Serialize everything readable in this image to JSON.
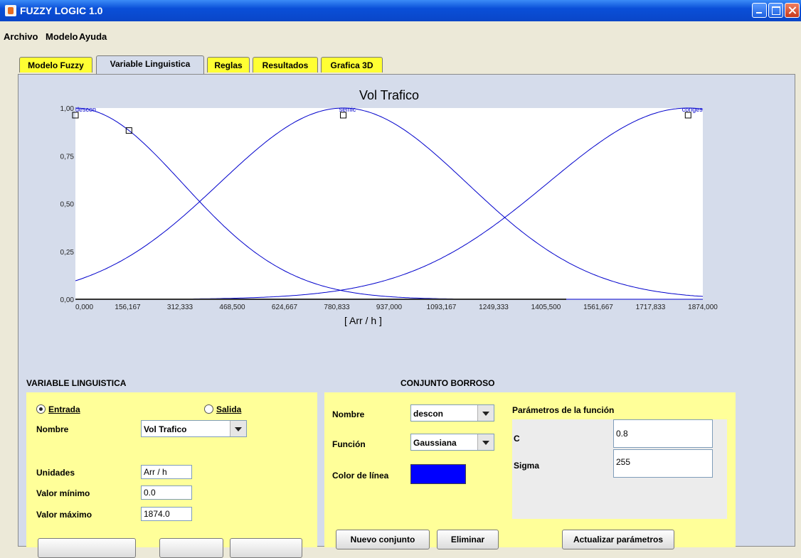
{
  "window": {
    "title": "FUZZY LOGIC 1.0"
  },
  "menu": [
    "Archivo",
    "Modelo",
    "Ayuda"
  ],
  "tabs": [
    {
      "label": "Modelo Fuzzy",
      "active": false
    },
    {
      "label": "Variable Linguistica",
      "active": true
    },
    {
      "label": "Reglas",
      "active": false
    },
    {
      "label": "Resultados",
      "active": false
    },
    {
      "label": "Grafica 3D",
      "active": false
    }
  ],
  "chart_data": {
    "type": "line",
    "title": "Vol Trafico",
    "xlabel": "[ Arr / h ]",
    "ylabel": "",
    "xlim": [
      0,
      1874
    ],
    "ylim": [
      0,
      1
    ],
    "x_ticks": [
      "0,000",
      "156,167",
      "312,333",
      "468,500",
      "624,667",
      "780,833",
      "937,000",
      "1093,167",
      "1249,333",
      "1405,500",
      "1561,667",
      "1717,833",
      "1874,000"
    ],
    "y_ticks": [
      "0,00",
      "0,25",
      "0,50",
      "0,75",
      "1,00"
    ],
    "series": [
      {
        "name": "descon",
        "function": "gaussian",
        "center": 0,
        "sigma": 320,
        "color": "#0000cc"
      },
      {
        "name": "semic",
        "function": "gaussian",
        "center": 800,
        "sigma": 370,
        "color": "#0000cc"
      },
      {
        "name": "conges",
        "function": "gaussian",
        "center": 1830,
        "sigma": 420,
        "color": "#0000cc"
      }
    ],
    "grid": false
  },
  "variable": {
    "section_title": "VARIABLE LINGUISTICA",
    "radio_entrada": "Entrada",
    "radio_salida": "Salida",
    "selected": "Entrada",
    "nombre_label": "Nombre",
    "nombre_value": "Vol Trafico",
    "unidades_label": "Unidades",
    "unidades_value": "Arr / h",
    "min_label": "Valor mínimo",
    "min_value": "0.0",
    "max_label": "Valor máximo",
    "max_value": "1874.0"
  },
  "conjunto": {
    "section_title": "CONJUNTO BORROSO",
    "nombre_label": "Nombre",
    "nombre_value": "descon",
    "funcion_label": "Función",
    "funcion_value": "Gaussiana",
    "color_label": "Color de línea",
    "line_color": "#0000ff",
    "params_title": "Parámetros de la función",
    "c_label": "C",
    "c_value": "0.8",
    "sigma_label": "Sigma",
    "sigma_value": "255",
    "nuevo_button": "Nuevo conjunto",
    "eliminar_button": "Eliminar",
    "actualizar_button": "Actualizar parámetros"
  },
  "colors": {
    "tab_yellow": "#ffff33",
    "panel_blue": "#d5dceb",
    "form_yellow": "#ffff99",
    "curve": "#0000cc"
  }
}
